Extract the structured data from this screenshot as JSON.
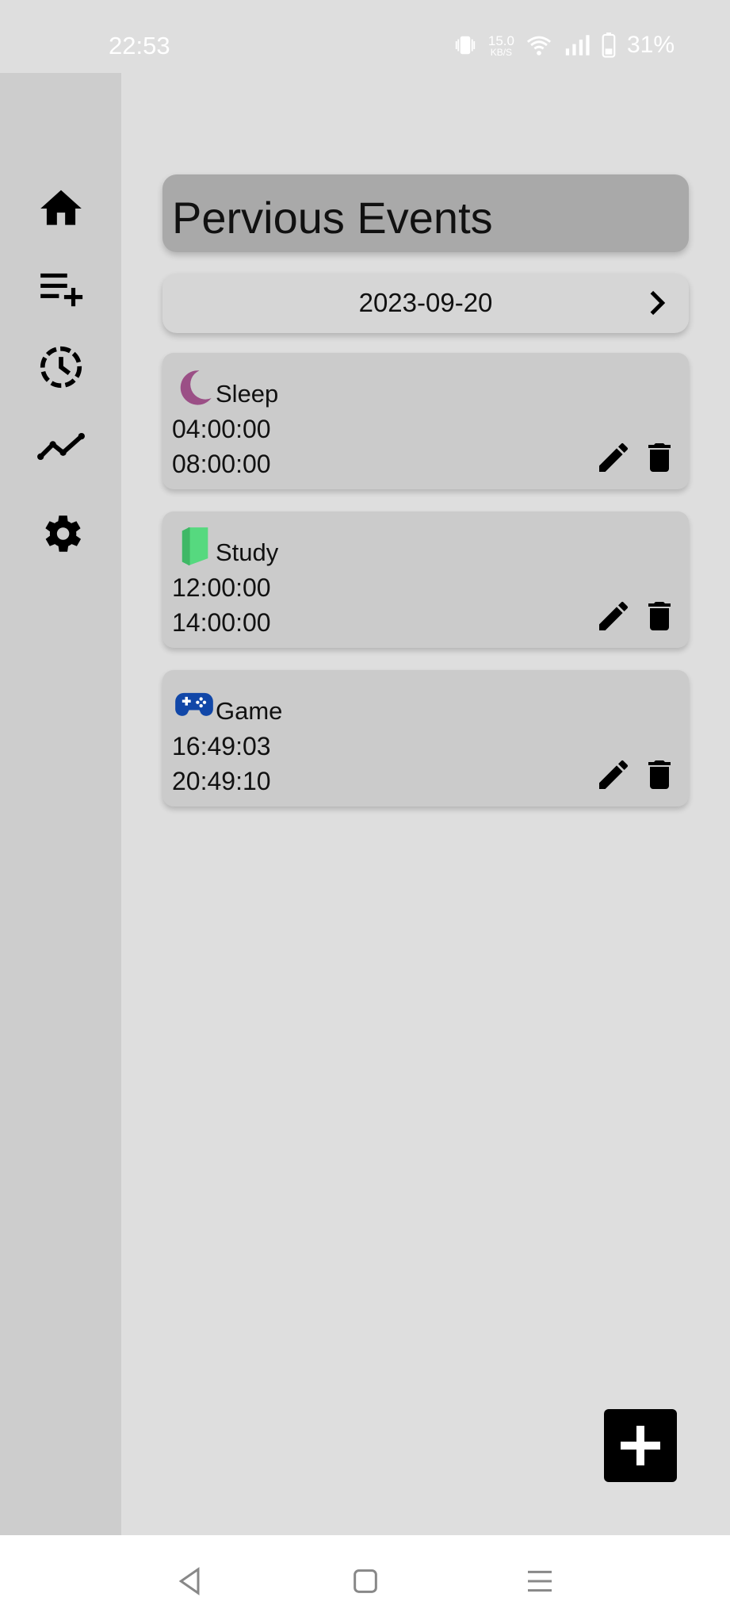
{
  "status_bar": {
    "time": "22:53",
    "net_speed_value": "15.0",
    "net_speed_unit": "KB/S",
    "battery": "31%"
  },
  "sidebar": {
    "items": [
      {
        "icon": "home-icon"
      },
      {
        "icon": "playlist-add-icon"
      },
      {
        "icon": "history-icon"
      },
      {
        "icon": "trend-line-icon"
      },
      {
        "icon": "gear-icon"
      }
    ]
  },
  "header": {
    "title": "Pervious Events"
  },
  "date_bar": {
    "date": "2023-09-20",
    "next_icon": "chevron-right-icon"
  },
  "events": [
    {
      "name": "Sleep",
      "icon": "moon-icon",
      "icon_color": "#9b4f86",
      "start": "04:00:00",
      "end": "08:00:00"
    },
    {
      "name": "Study",
      "icon": "book-icon",
      "icon_color": "#56d97f",
      "start": "12:00:00",
      "end": "14:00:00"
    },
    {
      "name": "Game",
      "icon": "gamepad-icon",
      "icon_color": "#1147a8",
      "start": "16:49:03",
      "end": "20:49:10"
    }
  ],
  "fab": {
    "icon": "plus-icon"
  },
  "colors": {
    "background": "#dedede",
    "sidebar": "#cdcdcd",
    "header": "#a9a9a9",
    "card": "#cbcbcb"
  }
}
